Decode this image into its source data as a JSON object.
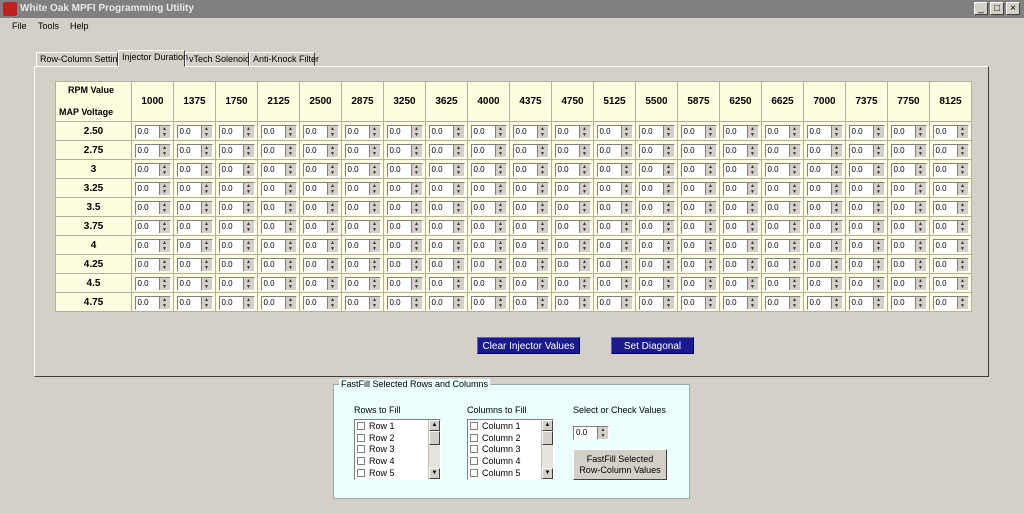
{
  "window": {
    "title": "White Oak MPFI Programming Utility",
    "min": "_",
    "max": "□",
    "close": "×"
  },
  "menu": [
    "File",
    "Tools",
    "Help"
  ],
  "tabs": [
    "Row-Column Settings",
    "Injector Duration",
    "vTech Solenoid",
    "Anti-Knock Filter"
  ],
  "active_tab": 1,
  "grid": {
    "rpm_label": "RPM Value",
    "map_label": "MAP Voltage",
    "rpm_values": [
      "1000",
      "1375",
      "1750",
      "2125",
      "2500",
      "2875",
      "3250",
      "3625",
      "4000",
      "4375",
      "4750",
      "5125",
      "5500",
      "5875",
      "6250",
      "6625",
      "7000",
      "7375",
      "7750",
      "8125"
    ],
    "map_values": [
      "2.50",
      "2.75",
      "3",
      "3.25",
      "3.5",
      "3.75",
      "4",
      "4.25",
      "4.5",
      "4.75"
    ],
    "cell_value": "0.0"
  },
  "buttons": {
    "clear": "Clear Injector Values",
    "diagonal": "Set Diagonal"
  },
  "fastfill": {
    "legend": "FastFill Selected Rows and Columns",
    "rows_label": "Rows to Fill",
    "columns_label": "Columns to Fill",
    "values_label": "Select or Check Values",
    "rows": [
      "Row 1",
      "Row 2",
      "Row 3",
      "Row 4",
      "Row 5"
    ],
    "columns": [
      "Column 1",
      "Column 2",
      "Column 3",
      "Column 4",
      "Column 5"
    ],
    "value": "0.0",
    "button_line1": "FastFill Selected",
    "button_line2": "Row-Column Values"
  }
}
